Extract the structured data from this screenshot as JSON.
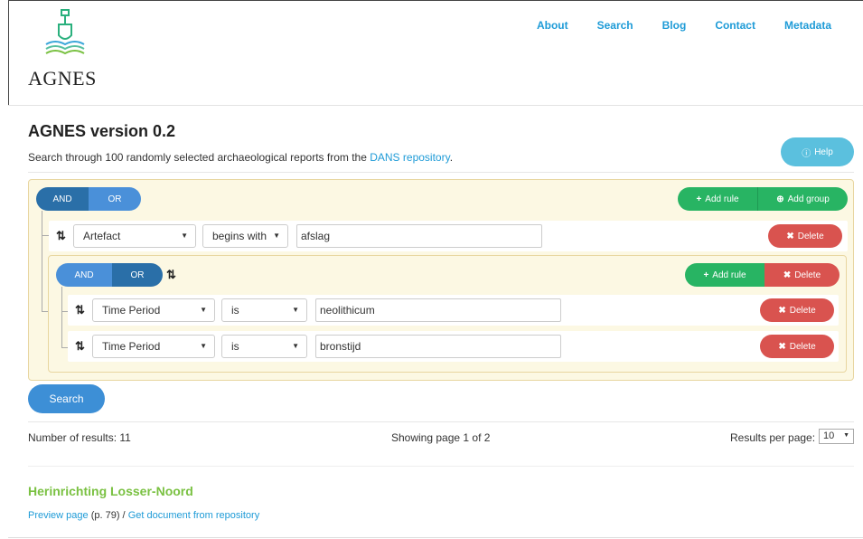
{
  "logo": {
    "text": "AGNES",
    "icon": "shovel-book-icon"
  },
  "nav": [
    "About",
    "Search",
    "Blog",
    "Contact",
    "Metadata"
  ],
  "page": {
    "title": "AGNES version 0.2",
    "subtitle_prefix": "Search through 100 randomly selected archaeological reports from the ",
    "subtitle_link": "DANS repository",
    "subtitle_suffix": ".",
    "help": "Help"
  },
  "builder": {
    "and": "AND",
    "or": "OR",
    "add_rule": "Add rule",
    "add_group": "Add group",
    "delete": "Delete",
    "rules": [
      {
        "field": "Artefact",
        "operator": "begins with",
        "value": "afslag"
      },
      {
        "field": "Time Period",
        "operator": "is",
        "value": "neolithicum"
      },
      {
        "field": "Time Period",
        "operator": "is",
        "value": "bronstijd"
      }
    ]
  },
  "search_label": "Search",
  "results": {
    "count": "Number of results: 11",
    "paging": "Showing page 1 of 2",
    "per_page_label": "Results per page:",
    "per_page_value": "10",
    "item_title": "Herinrichting Losser-Noord",
    "preview": "Preview page",
    "page_ref": " (p. 79) / ",
    "get_doc": "Get document from repository"
  },
  "colors": {
    "accent": "#1e9bd7",
    "green": "#28b463",
    "red": "#d9534f",
    "panel": "#fcf8e3"
  }
}
